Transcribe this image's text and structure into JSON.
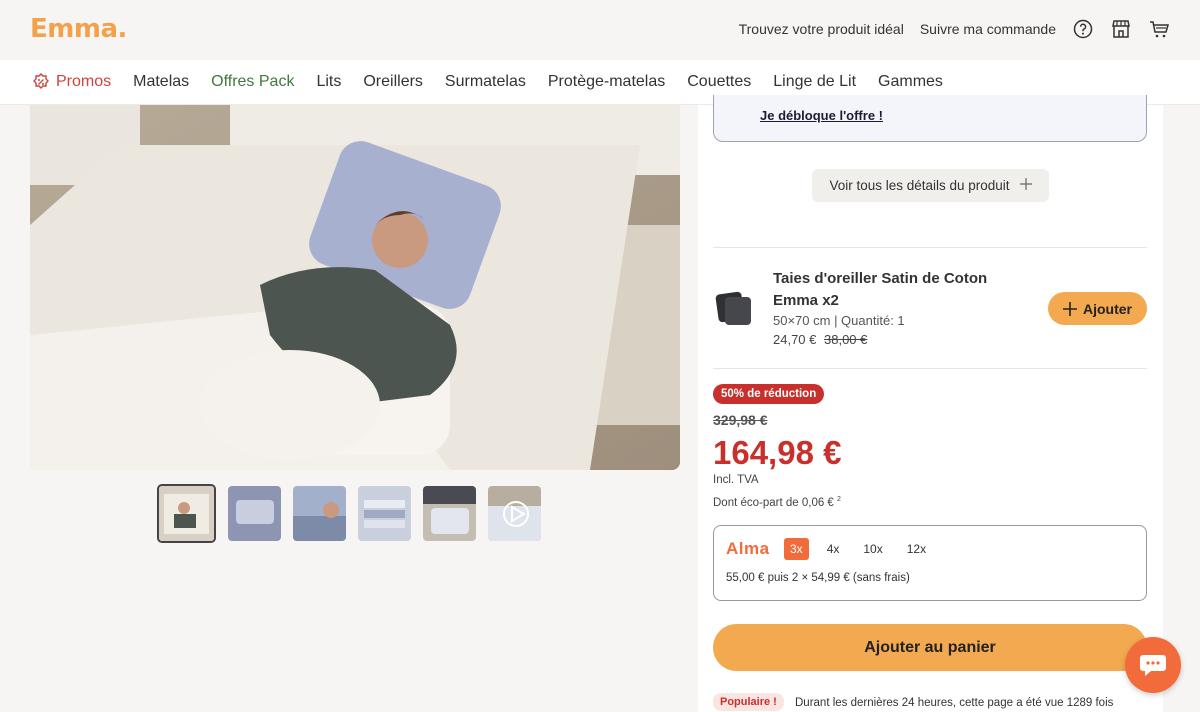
{
  "header": {
    "logo": "Emma",
    "links": [
      "Trouvez votre produit idéal",
      "Suivre ma commande"
    ],
    "icons": [
      "help-icon",
      "store-icon",
      "cart-icon"
    ]
  },
  "nav": {
    "items": [
      "Promos",
      "Matelas",
      "Offres Pack",
      "Lits",
      "Oreillers",
      "Surmatelas",
      "Protège-matelas",
      "Couettes",
      "Linge de Lit",
      "Gammes"
    ]
  },
  "gallery": {
    "thumb_count": 6,
    "active_index": 0
  },
  "product": {
    "offer_link": "Je débloque l'offre !",
    "details_button": "Voir tous les détails du produit",
    "upsell": {
      "title": "Taies d'oreiller Satin de Coton Emma x2",
      "meta": "50×70 cm | Quantité: 1",
      "price": "24,70 €",
      "old_price": "38,00 €",
      "add_label": "Ajouter"
    },
    "discount_badge": "50% de réduction",
    "old_price": "329,98 €",
    "price": "164,98 €",
    "tax_note": "Incl. TVA",
    "eco_note": "Dont éco-part de 0,06 €",
    "eco_sup": "2",
    "alma": {
      "brand": "Alma",
      "options": [
        "3x",
        "4x",
        "10x",
        "12x"
      ],
      "selected": "3x",
      "text": "55,00 € puis 2 × 54,99 € (sans frais)"
    },
    "cart_button": "Ajouter au panier",
    "popular_badge": "Populaire !",
    "popular_text": "Durant les dernières 24 heures, cette page a été vue 1289 fois"
  },
  "colors": {
    "brand": "#f3a24c",
    "sale_red": "#c9302c",
    "alma_orange": "#f26b3a",
    "pack_green": "#3e7a3e"
  }
}
